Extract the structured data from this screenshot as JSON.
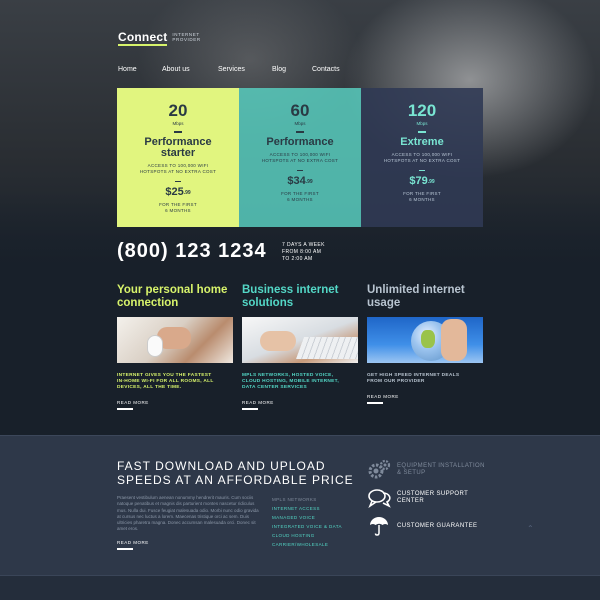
{
  "brand": {
    "name": "Connect",
    "tagline": "INTERNET PROVIDER"
  },
  "nav": {
    "items": [
      "Home",
      "About us",
      "Services",
      "Blog",
      "Contacts"
    ]
  },
  "plans": [
    {
      "speed": "20",
      "unit": "Mbps",
      "name": "Performance starter",
      "desc": "ACCESS TO 100,000 WIFI HOTSPOTS AT NO EXTRA COST",
      "price": "$25",
      "cents": ".99",
      "note": "FOR THE FIRST 6 MONTHS"
    },
    {
      "speed": "60",
      "unit": "Mbps",
      "name": "Performance",
      "desc": "ACCESS TO 100,000 WIFI HOTSPOTS AT NO EXTRA COST",
      "price": "$34",
      "cents": ".99",
      "note": "FOR THE FIRST 6 MONTHS"
    },
    {
      "speed": "120",
      "unit": "Mbps",
      "name": "Extreme",
      "desc": "ACCESS TO 100,000 WIFI HOTSPOTS AT NO EXTRA COST",
      "price": "$79",
      "cents": ".99",
      "note": "FOR THE FIRST 6 MONTHS"
    }
  ],
  "contact": {
    "phone": "(800) 123 1234",
    "hours": "7 DAYS A WEEK FROM 8:00 AM TO 2:00 AM"
  },
  "features": [
    {
      "title": "Your personal home connection",
      "text": "INTERNET GIVES YOU THE FASTEST IN-HOME WI-FI FOR ALL ROOMS, ALL DEVICES, ALL THE TIME.",
      "more": "READ MORE"
    },
    {
      "title": "Business internet solutions",
      "text": "MPLS NETWORKS, HOSTED VOICE, CLOUD HOSTING, MOBILE INTERNET, DATA CENTER SERVICES",
      "more": "READ MORE"
    },
    {
      "title": "Unlimited internet usage",
      "text": "GET HIGH SPEED INTERNET DEALS FROM OUR PROVIDER",
      "more": "READ MORE"
    }
  ],
  "bottom": {
    "title": "FAST DOWNLOAD AND UPLOAD SPEEDS AT AN AFFORDABLE PRICE",
    "para": "Praesent vestibulum aenean nonummy hendrerit mauris. Cum sociis natoque penatibus et magnis dis parturient montes nascetur ridiculus mus. Nulla dui. Fusce feugiat malesuada odio. Morbi nunc odio gravida at cursus nec luctus a lorem. Maecenas tristique orci ac sem. Duis ultricies pharetra magna. Donec accumsan malesuada orci. Donec sit amet eros.",
    "more": "READ MORE",
    "links": [
      "MPLS NETWORKS",
      "INTERNET ACCESS",
      "MANAGED VOICE",
      "INTEGRATED VOICE & DATA",
      "CLOUD HOSTING",
      "CARRIER/WHOLESALE"
    ],
    "services": [
      {
        "icon": "gears-icon",
        "label": "EQUIPMENT INSTALLATION & SETUP"
      },
      {
        "icon": "chat-bubbles-icon",
        "label": "CUSTOMER SUPPORT CENTER"
      },
      {
        "icon": "umbrella-icon",
        "label": "CUSTOMER GUARANTEE"
      }
    ]
  },
  "colors": {
    "lime": "#e1f57f",
    "teal": "#58cdbe",
    "navy": "#303a54",
    "bottom_bg": "#2e3849"
  }
}
